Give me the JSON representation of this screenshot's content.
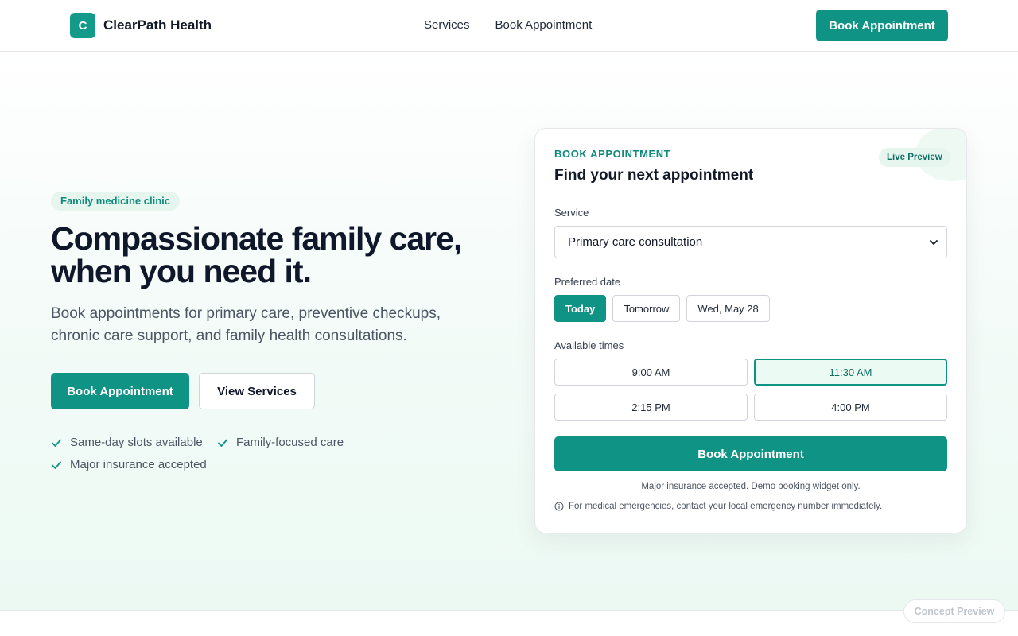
{
  "colors": {
    "brand": "#0f9384",
    "accent_light": "#e6f6ef",
    "text": "#111827"
  },
  "header": {
    "logo_letter": "C",
    "brand_name": "ClearPath Health",
    "nav": [
      "Services",
      "Book Appointment"
    ],
    "cta_label": "Book Appointment"
  },
  "hero": {
    "eyebrow": "Family medicine clinic",
    "title_line1": "Compassionate family care,",
    "title_line2": "when you need it.",
    "subtitle": "Book appointments for primary care, preventive checkups, chronic care support, and family health consultations.",
    "primary_button": "Book Appointment",
    "secondary_button": "View Services",
    "features": [
      "Same-day slots available",
      "Family-focused care",
      "Major insurance accepted"
    ]
  },
  "booking": {
    "eyebrow": "BOOK APPOINTMENT",
    "title": "Find your next appointment",
    "badge": "Live Preview",
    "service_label": "Service",
    "service_value": "Primary care consultation",
    "date_label": "Preferred date",
    "dates": [
      "Today",
      "Tomorrow",
      "Wed, May 28"
    ],
    "selected_date": "Today",
    "times_label": "Available times",
    "times": [
      "9:00 AM",
      "11:30 AM",
      "2:15 PM",
      "4:00 PM"
    ],
    "selected_time": "11:30 AM",
    "submit_label": "Book Appointment",
    "note": "Major insurance accepted. Demo booking widget only.",
    "warning": "For medical emergencies, contact your local emergency number immediately."
  },
  "concept_badge": "Concept Preview",
  "icons": {
    "check": "check-icon",
    "chevron": "chevron-down-icon",
    "info": "info-icon"
  }
}
